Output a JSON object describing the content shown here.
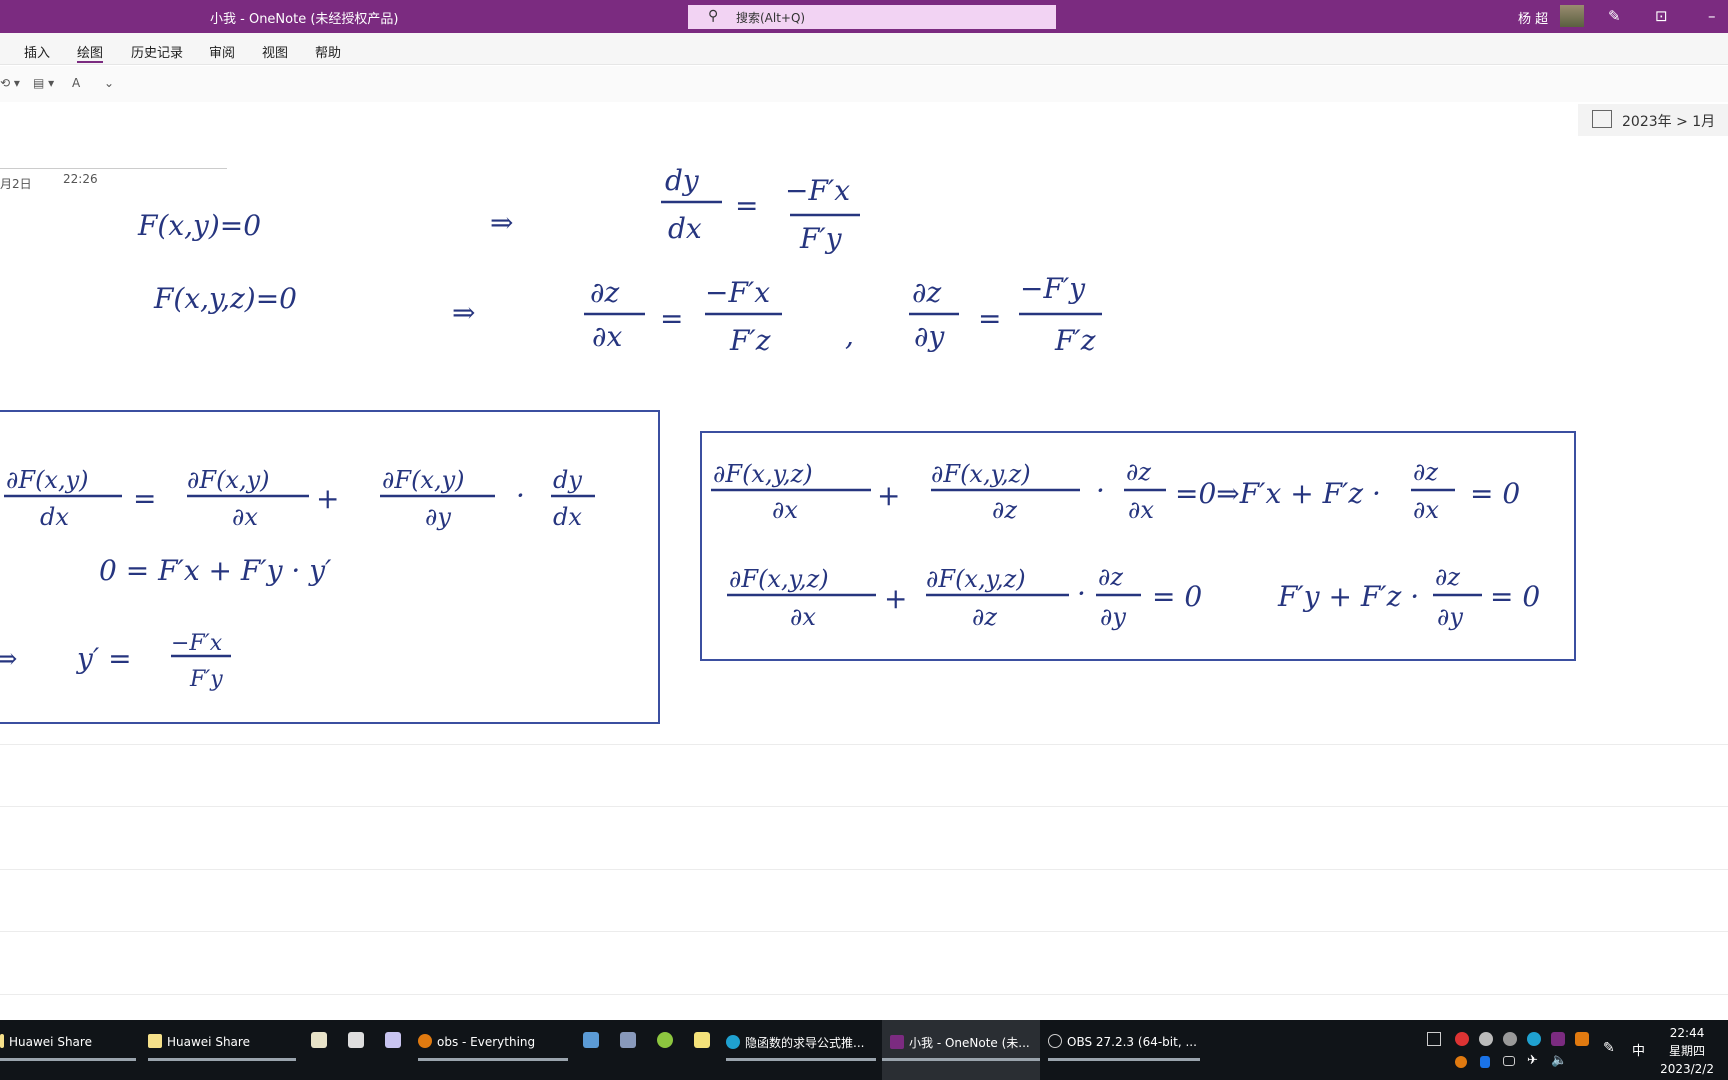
{
  "titlebar": {
    "title": "小我 - OneNote (未经授权产品)",
    "search_placeholder": "搜索(Alt+Q)",
    "user": "杨 超"
  },
  "ribbon": {
    "tabs": [
      "插入",
      "绘图",
      "历史记录",
      "审阅",
      "视图",
      "帮助"
    ]
  },
  "breadcrumb": "2023年 > 1月",
  "page": {
    "date": "月2日",
    "time": "22:26"
  },
  "ink": {
    "e1": "F(x,y)=0",
    "arrow": "⇒",
    "dy": "dy",
    "dx": "dx",
    "eq": "=",
    "mFx": "−F′x",
    "Fy": "F′y",
    "e2": "F(x,y,z)=0",
    "dz": "∂z",
    "ddx": "∂x",
    "Fz": "F′z",
    "comma": ",",
    "ddy": "∂y",
    "mFy": "−F′y",
    "b1": {
      "dFxy": "∂F(x,y)",
      "dx": "dx",
      "dFxy2": "∂F(x,y)",
      "ddx": "∂x",
      "plus": "+",
      "ddy": "∂y",
      "dot": "·",
      "dy": "dy",
      "l2": "0 = F′x + F′y · y′",
      "l3": "⇒",
      "yp": "y′ =",
      "mFx": "−F′x",
      "Fy": "F′y"
    },
    "b2": {
      "dFxyz": "∂F(x,y,z)",
      "ddx": "∂x",
      "plus": "+",
      "ddz": "∂z",
      "dot": "·",
      "dz": "∂z",
      "ddy": "∂y",
      "r1tail": "=0⇒F′x + F′z ·",
      "eq0": "= 0",
      "r2eq0": "= 0",
      "r2tail": "F′y + F′z ·"
    }
  },
  "taskbar": {
    "items": [
      "Huawei Share",
      "Huawei Share",
      "obs - Everything",
      "隐函数的求导公式推...",
      "小我 - OneNote (未...",
      "OBS 27.2.3 (64-bit, ..."
    ],
    "time": "22:44",
    "weekday": "星期四",
    "date": "2023/2/2",
    "ime": "中"
  },
  "colors": {
    "titlebar": "#7B2B80",
    "ink": "#26357F",
    "box": "#3B4FA0",
    "taskbar": "#101418"
  }
}
